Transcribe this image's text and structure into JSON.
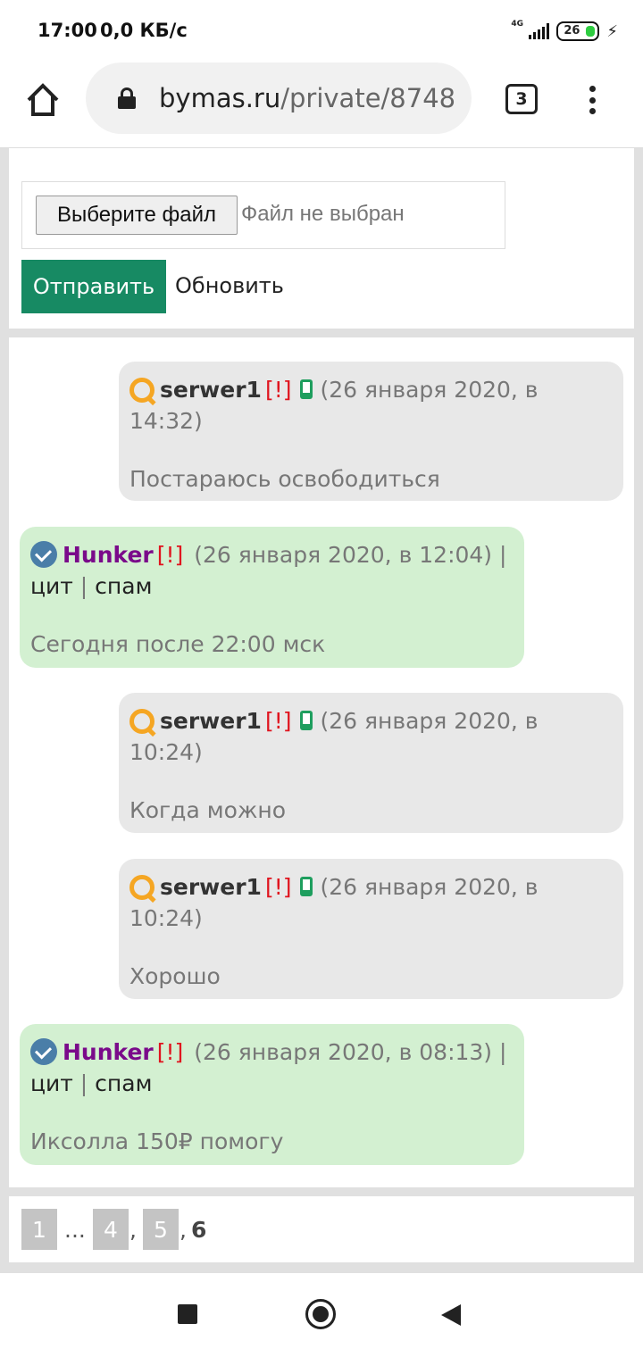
{
  "status_bar": {
    "time": "17:00",
    "speed": "0,0 КБ/с",
    "network": "4G",
    "battery": "26"
  },
  "browser": {
    "url_domain": "bymas.ru",
    "url_path": "/private/8748",
    "tabs_count": "3"
  },
  "upload": {
    "choose_file_label": "Выберите файл",
    "no_file_label": "Файл не выбран",
    "send_label": "Отправить",
    "refresh_label": "Обновить"
  },
  "messages": [
    {
      "author": "serwer1",
      "flag": "[!]",
      "date": "(26 января 2020, в 14:32)",
      "text": "Постараюсь освободиться"
    },
    {
      "author": "Hunker",
      "flag": "[!]",
      "date": "(26 января 2020, в 12:04)",
      "actions": [
        "цит",
        "спам"
      ],
      "text": "Сегодня после 22:00 мск"
    },
    {
      "author": "serwer1",
      "flag": "[!]",
      "date": "(26 января 2020, в 10:24)",
      "text": "Когда можно"
    },
    {
      "author": "serwer1",
      "flag": "[!]",
      "date": "(26 января 2020, в 10:24)",
      "text": "Хорошо"
    },
    {
      "author": "Hunker",
      "flag": "[!]",
      "date": "(26 января 2020, в 08:13)",
      "actions": [
        "цит",
        "спам"
      ],
      "text": "Иксолла 150₽ помогу"
    }
  ],
  "pagination": {
    "pages": [
      "1",
      "...",
      "4",
      ",",
      "5",
      ",",
      "6"
    ]
  },
  "colors": {
    "send_button": "#178a63",
    "incoming_bubble": "#e8e8e8",
    "outgoing_bubble": "#d3f0d1",
    "flag_red": "#e0141e",
    "hunker_nick": "#7a0a8a"
  }
}
